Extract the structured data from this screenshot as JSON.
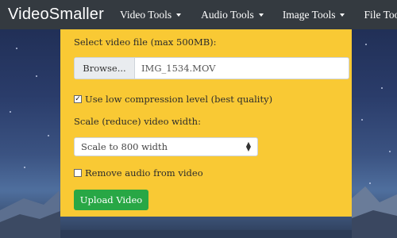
{
  "navbar": {
    "brand": "VideoSmaller",
    "items": [
      {
        "label": "Video Tools"
      },
      {
        "label": "Audio Tools"
      },
      {
        "label": "Image Tools"
      },
      {
        "label": "File Tools"
      }
    ]
  },
  "form": {
    "file_label": "Select video file (max 500MB):",
    "browse_label": "Browse...",
    "file_name": "IMG_1534.MOV",
    "low_compression_label": "Use low compression level (best quality)",
    "low_compression_checked": true,
    "scale_label": "Scale (reduce) video width:",
    "scale_selected": "Scale to 800 width",
    "remove_audio_label": "Remove audio from video",
    "remove_audio_checked": false,
    "upload_label": "Upload Video"
  },
  "colors": {
    "navbar": "#343a40",
    "panel": "#f9c934",
    "upload_button": "#28a745"
  }
}
